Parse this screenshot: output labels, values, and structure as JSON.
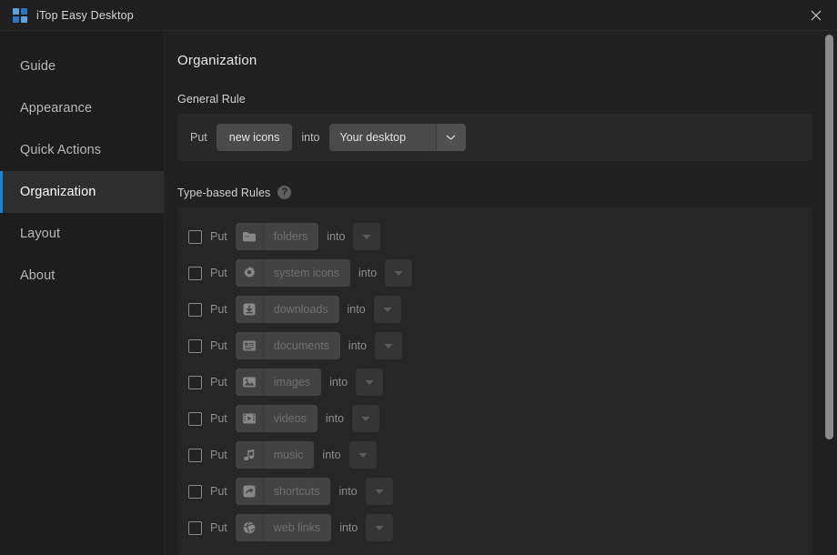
{
  "window": {
    "title": "iTop Easy Desktop",
    "logo_icon": "app-grid-icon",
    "close_icon": "close-icon",
    "accent_color": "#1784d6",
    "background_color": "#202020"
  },
  "sidebar": {
    "items": [
      {
        "label": "Guide",
        "active": false
      },
      {
        "label": "Appearance",
        "active": false
      },
      {
        "label": "Quick Actions",
        "active": false
      },
      {
        "label": "Organization",
        "active": true
      },
      {
        "label": "Layout",
        "active": false
      },
      {
        "label": "About",
        "active": false
      }
    ]
  },
  "main": {
    "page_title": "Organization",
    "general_rule": {
      "section_label": "General Rule",
      "put_label": "Put",
      "subject": "new icons",
      "into_label": "into",
      "destination": "Your desktop",
      "dropdown_icon": "chevron-down-icon"
    },
    "type_rules": {
      "section_label": "Type-based Rules",
      "help_icon": "question-mark-icon",
      "help_glyph": "?",
      "put_label": "Put",
      "into_label": "into",
      "dropdown_icon": "triangle-down-icon",
      "rows": [
        {
          "type": "folders",
          "icon": "folder-icon",
          "checked": false
        },
        {
          "type": "system icons",
          "icon": "gear-icon",
          "checked": false
        },
        {
          "type": "downloads",
          "icon": "download-icon",
          "checked": false
        },
        {
          "type": "documents",
          "icon": "document-icon",
          "checked": false
        },
        {
          "type": "images",
          "icon": "image-icon",
          "checked": false
        },
        {
          "type": "videos",
          "icon": "video-icon",
          "checked": false
        },
        {
          "type": "music",
          "icon": "music-icon",
          "checked": false
        },
        {
          "type": "shortcuts",
          "icon": "shortcut-icon",
          "checked": false
        },
        {
          "type": "web links",
          "icon": "globe-icon",
          "checked": false
        }
      ]
    }
  },
  "scrollbar": {
    "orientation": "vertical",
    "thumb_position_percent": 0
  }
}
